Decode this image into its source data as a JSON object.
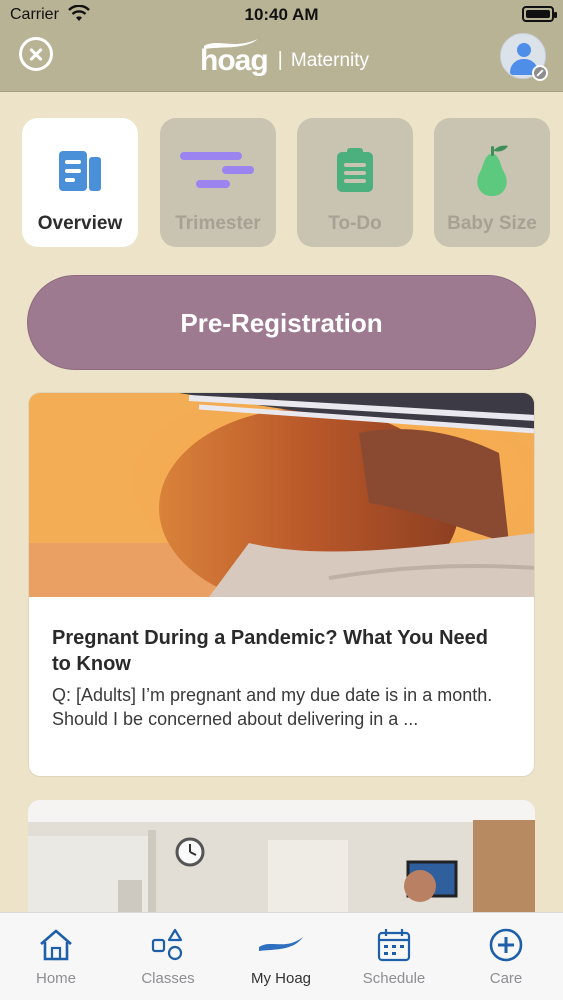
{
  "status_bar": {
    "carrier": "Carrier",
    "time": "10:40 AM"
  },
  "header": {
    "logo_text": "hoag",
    "separator": "|",
    "title": "Maternity"
  },
  "tiles": [
    {
      "label": "Overview",
      "icon": "overview-icon",
      "active": true,
      "color": "#4a90d9"
    },
    {
      "label": "Trimester",
      "icon": "trimester-icon",
      "active": false,
      "color": "#8b6cf0"
    },
    {
      "label": "To-Do",
      "icon": "clipboard-icon",
      "active": false,
      "color": "#3fa874"
    },
    {
      "label": "Baby Size",
      "icon": "pear-icon",
      "active": false,
      "color": "#58c77a"
    }
  ],
  "prereg_label": "Pre-Registration",
  "articles": [
    {
      "headline": "Pregnant During a Pandemic? What You Need to Know",
      "excerpt": "Q: [Adults] I’m pregnant and my due date is in a month. Should I be concerned about delivering in a ..."
    }
  ],
  "tabbar": [
    {
      "label": "Home",
      "icon": "home-icon",
      "active": false
    },
    {
      "label": "Classes",
      "icon": "shapes-icon",
      "active": false
    },
    {
      "label": "My Hoag",
      "icon": "hoag-wave-icon",
      "active": true
    },
    {
      "label": "Schedule",
      "icon": "calendar-icon",
      "active": false
    },
    {
      "label": "Care",
      "icon": "plus-circle-icon",
      "active": false
    }
  ],
  "colors": {
    "header_bg": "#b9b396",
    "page_bg": "#ece3c8",
    "accent": "#9e7a90",
    "brand_blue": "#2f6fc0"
  }
}
